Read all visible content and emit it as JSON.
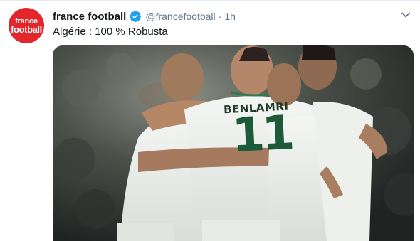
{
  "account": {
    "display_name": "france football",
    "handle": "@francefootball",
    "separator": "·",
    "time": "1h",
    "avatar_line1": "france",
    "avatar_line2": "football"
  },
  "tweet": {
    "text": "Algérie : 100 % Robusta"
  },
  "media": {
    "jersey_name": "BENLAMRI",
    "jersey_number": "11"
  },
  "colors": {
    "avatar_bg": "#e3262b",
    "verified": "#1da1f2",
    "text_primary": "#14171a",
    "text_secondary": "#657786"
  },
  "icons": {
    "verified": "verified-badge-icon",
    "more": "chevron-down-icon"
  }
}
